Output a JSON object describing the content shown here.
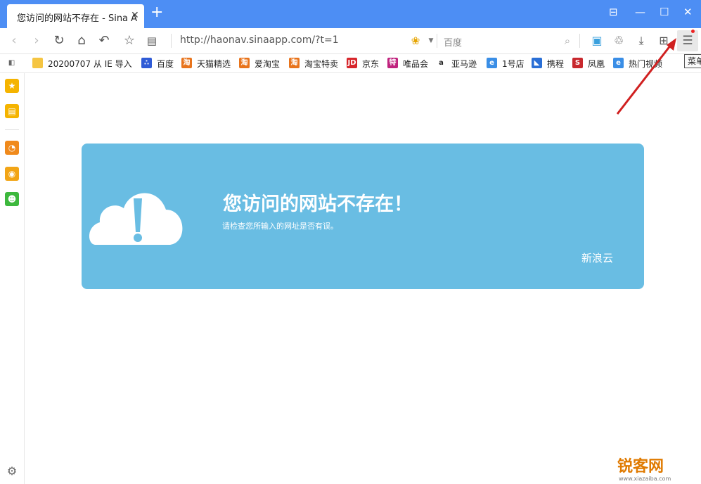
{
  "tab": {
    "title": "您访问的网站不存在 - Sina A",
    "close": "✕",
    "new_tab": "+"
  },
  "window_controls": {
    "layout": "⊟",
    "minimize": "—",
    "maximize": "☐",
    "close": "✕"
  },
  "toolbar": {
    "url": "http://haonav.sinaapp.com/?t=1",
    "search_placeholder": "百度"
  },
  "bookmarks": [
    {
      "label": "20200707 从 IE 导入",
      "icon": "folder-icon",
      "color": "#f5c542"
    },
    {
      "label": "百度",
      "icon": "baidu-icon",
      "color": "#2f5bd6"
    },
    {
      "label": "天猫精选",
      "icon": "taobao-icon",
      "color": "#e8741c"
    },
    {
      "label": "爱淘宝",
      "icon": "taobao-icon",
      "color": "#e8741c"
    },
    {
      "label": "淘宝特卖",
      "icon": "taobao-icon",
      "color": "#e8741c"
    },
    {
      "label": "京东",
      "icon": "jd-icon",
      "color": "#d7262b"
    },
    {
      "label": "唯品会",
      "icon": "vip-icon",
      "color": "#c0237e"
    },
    {
      "label": "亚马逊",
      "icon": "amazon-icon",
      "color": "#222222"
    },
    {
      "label": "1号店",
      "icon": "ie-icon",
      "color": "#3a8ee6"
    },
    {
      "label": "携程",
      "icon": "ctrip-icon",
      "color": "#2a6fd6"
    },
    {
      "label": "凤凰",
      "icon": "ifeng-icon",
      "color": "#c8282d"
    },
    {
      "label": "热门视频",
      "icon": "ie-icon",
      "color": "#3a8ee6"
    }
  ],
  "tooltip": "菜单",
  "error": {
    "title": "您访问的网站不存在！",
    "subtitle": "请检查您所输入的网址是否有误。",
    "brand": "新浪云"
  },
  "watermark": {
    "main": "锐客网",
    "sub": "www.xiazaiba.com"
  },
  "colors": {
    "titlebar": "#4d8ef4",
    "card": "#69bde3"
  }
}
